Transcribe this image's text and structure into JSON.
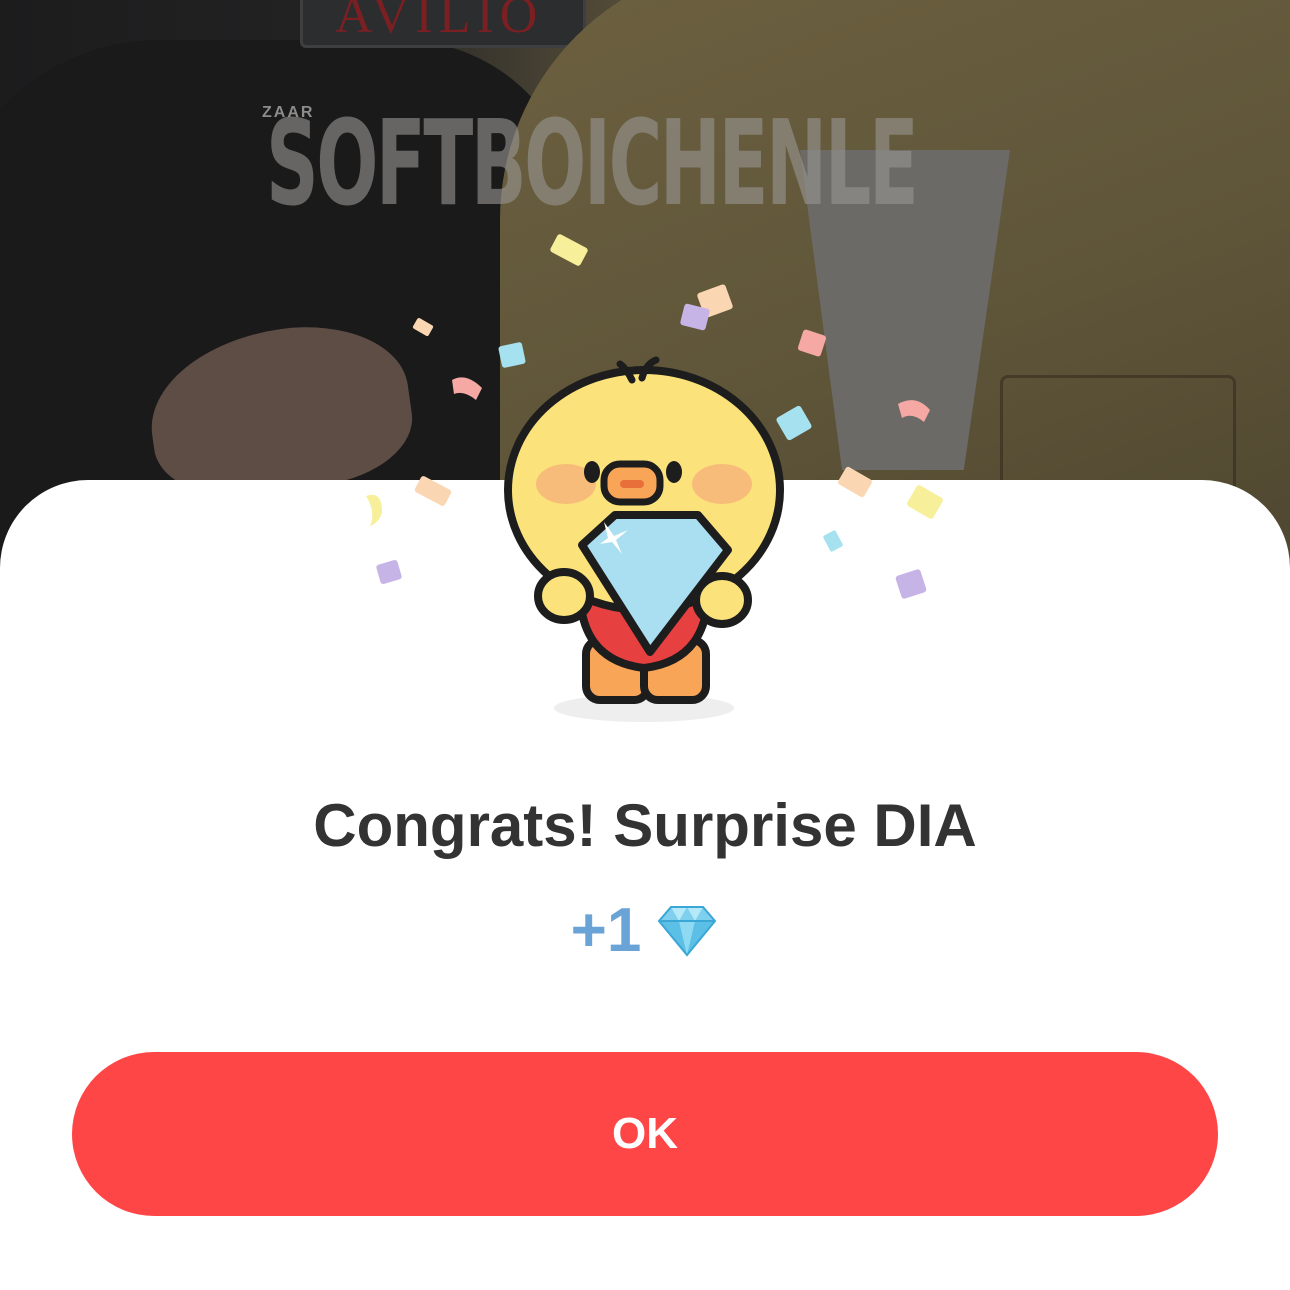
{
  "background": {
    "watermark": "SOFTBOICHENLE",
    "sign_text": "AVILIO",
    "vest_label": "ZAAR"
  },
  "popup": {
    "title": "Congrats! Surprise DIA",
    "reward_amount": "+1",
    "reward_icon": "diamond-icon",
    "mascot": "yellow-chick-holding-diamond",
    "ok_label": "OK"
  },
  "colors": {
    "accent_button": "#ff4646",
    "reward_text": "#6aa3d6",
    "title_text": "#333333",
    "sheet_background": "#ffffff"
  }
}
